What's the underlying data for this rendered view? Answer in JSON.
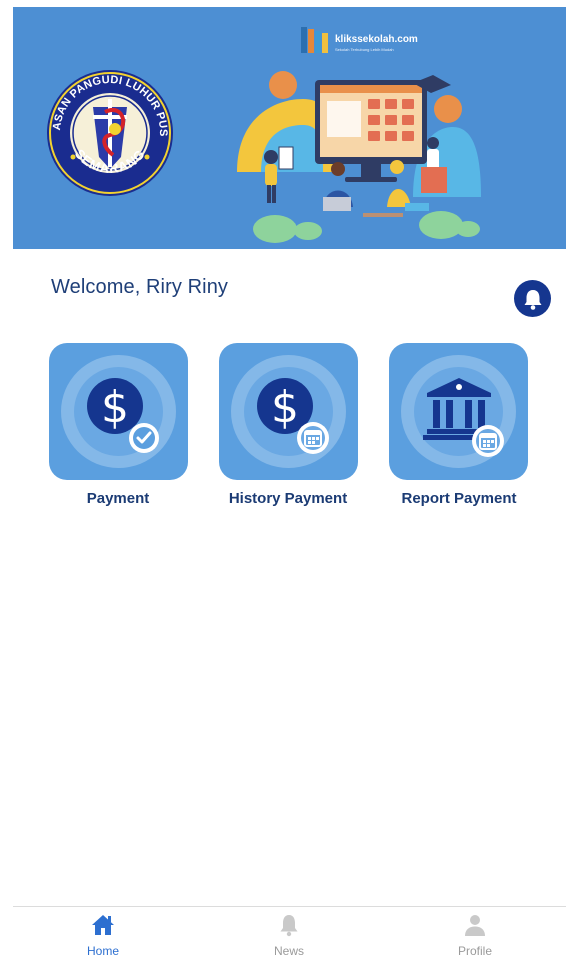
{
  "banner": {
    "logo_top_text": "YAYASAN PANGUDI LUHUR PUSAT",
    "logo_bottom_text": "SEMARANG",
    "brand_name": "klikssekolah.com",
    "brand_tagline": "Sekolah Terhubung Lebih Mudah"
  },
  "header": {
    "welcome_text": "Welcome, Riry Riny"
  },
  "menu": {
    "items": [
      {
        "label": "Payment",
        "icon": "dollar-check-icon"
      },
      {
        "label": "History Payment",
        "icon": "dollar-calendar-icon"
      },
      {
        "label": "Report Payment",
        "icon": "bank-calendar-icon"
      }
    ]
  },
  "bottom_nav": {
    "items": [
      {
        "label": "Home",
        "icon": "home-icon",
        "active": true
      },
      {
        "label": "News",
        "icon": "bell-icon",
        "active": false
      },
      {
        "label": "Profile",
        "icon": "person-icon",
        "active": false
      }
    ]
  },
  "colors": {
    "banner_bg": "#4d8fd3",
    "tile_bg": "#5b9fdf",
    "icon_dark": "#15368f",
    "text_primary": "#1f3f78",
    "nav_active": "#2d6fd0",
    "nav_inactive": "#9a9a9a"
  }
}
